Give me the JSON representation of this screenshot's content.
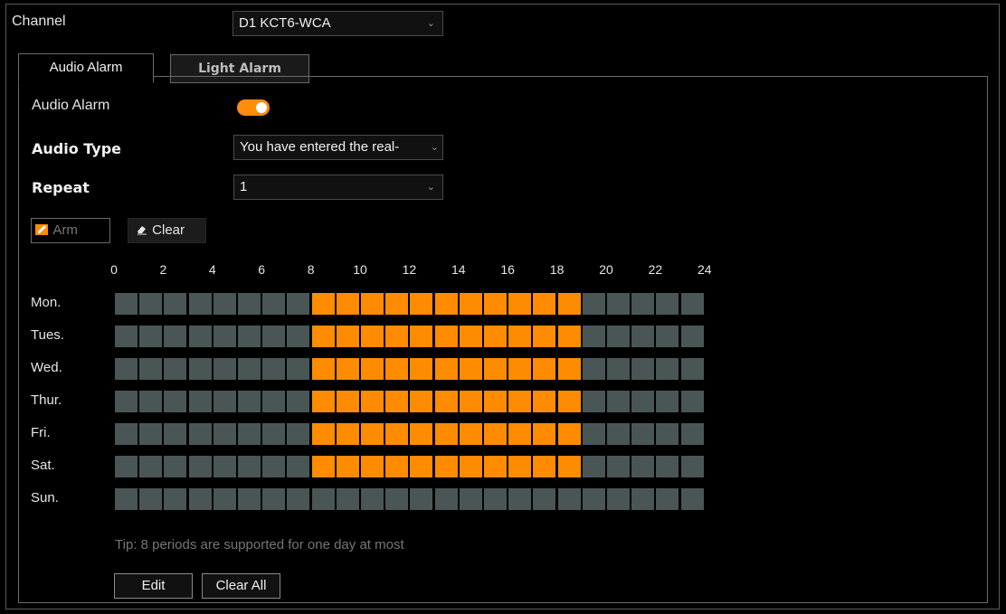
{
  "channel": {
    "label": "Channel",
    "value": "D1 KCT6-WCA"
  },
  "tabs": [
    {
      "label": "Audio Alarm",
      "active": true
    },
    {
      "label": "Light Alarm",
      "active": false
    }
  ],
  "audio_alarm": {
    "label": "Audio Alarm",
    "enabled": true
  },
  "audio_type": {
    "label": "Audio Type",
    "value": "You have entered the real-"
  },
  "repeat": {
    "label": "Repeat",
    "value": "1"
  },
  "toolbar": {
    "arm_label": "Arm",
    "clear_label": "Clear"
  },
  "schedule": {
    "hour_ticks": [
      "0",
      "2",
      "4",
      "6",
      "8",
      "10",
      "12",
      "14",
      "16",
      "18",
      "20",
      "22",
      "24"
    ],
    "days": [
      {
        "label": "Mon.",
        "armed_hours": [
          8,
          9,
          10,
          11,
          12,
          13,
          14,
          15,
          16,
          17,
          18
        ]
      },
      {
        "label": "Tues.",
        "armed_hours": [
          8,
          9,
          10,
          11,
          12,
          13,
          14,
          15,
          16,
          17,
          18
        ]
      },
      {
        "label": "Wed.",
        "armed_hours": [
          8,
          9,
          10,
          11,
          12,
          13,
          14,
          15,
          16,
          17,
          18
        ]
      },
      {
        "label": "Thur.",
        "armed_hours": [
          8,
          9,
          10,
          11,
          12,
          13,
          14,
          15,
          16,
          17,
          18
        ]
      },
      {
        "label": "Fri.",
        "armed_hours": [
          8,
          9,
          10,
          11,
          12,
          13,
          14,
          15,
          16,
          17,
          18
        ]
      },
      {
        "label": "Sat.",
        "armed_hours": [
          8,
          9,
          10,
          11,
          12,
          13,
          14,
          15,
          16,
          17,
          18
        ]
      },
      {
        "label": "Sun.",
        "armed_hours": []
      }
    ],
    "colors": {
      "armed": "#ff8c00",
      "idle": "#4a5656"
    }
  },
  "tip": "Tip: 8 periods are supported for one day at most",
  "buttons": {
    "edit_label": "Edit",
    "clear_all_label": "Clear All"
  },
  "colors": {
    "accent": "#ff8c0a"
  }
}
